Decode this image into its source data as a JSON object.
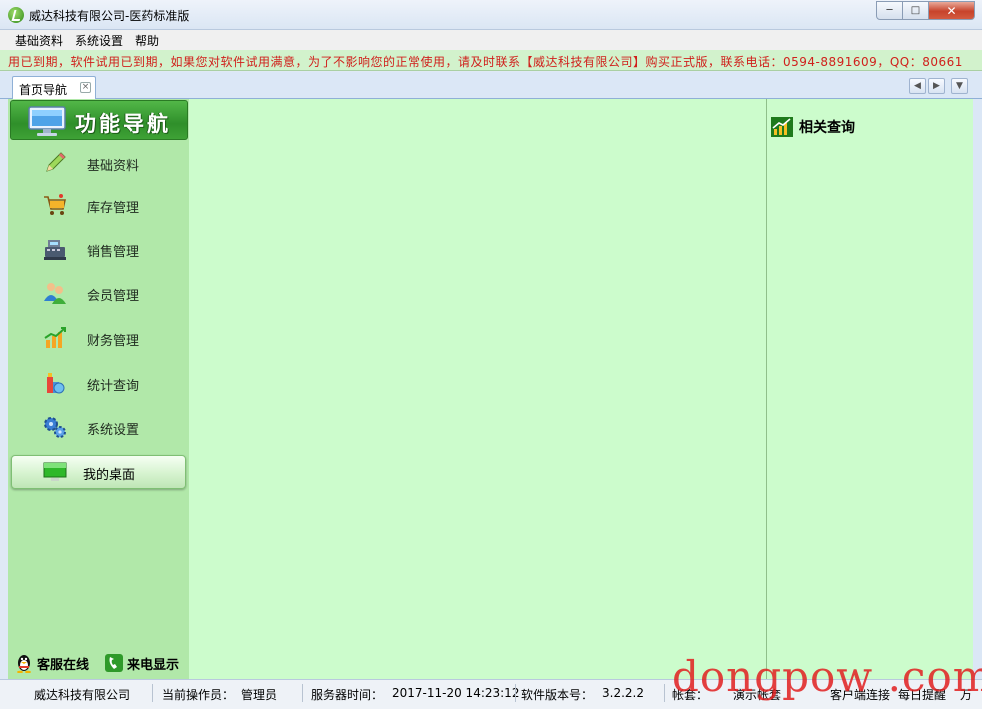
{
  "window": {
    "title": "威达科技有限公司-医药标准版",
    "minimize": "─",
    "maximize": "□",
    "close": "✕"
  },
  "menu": [
    "基础资料",
    "系统设置",
    "帮助"
  ],
  "marquee_text": "用已到期，软件试用已到期，如果您对软件试用满意，为了不影响您的正常使用，请及时联系【威达科技有限公司】购买正式版，联系电话：0594-8891609，QQ：80661",
  "tabs": [
    {
      "label": "首页导航"
    }
  ],
  "nav": {
    "header": "功能导航",
    "items": [
      {
        "label": "基础资料",
        "icon": "pencil-icon"
      },
      {
        "label": "库存管理",
        "icon": "cart-icon"
      },
      {
        "label": "销售管理",
        "icon": "cash-register-icon"
      },
      {
        "label": "会员管理",
        "icon": "members-icon"
      },
      {
        "label": "财务管理",
        "icon": "finance-chart-icon"
      },
      {
        "label": "统计查询",
        "icon": "stats-icon"
      },
      {
        "label": "系统设置",
        "icon": "gears-icon"
      }
    ],
    "desktop": "我的桌面",
    "service_online": "客服在线",
    "caller_display": "来电显示"
  },
  "right_panel": {
    "title": "相关查询"
  },
  "status": {
    "company": "威达科技有限公司",
    "operator_label": "当前操作员：",
    "operator": "管理员",
    "server_time_label": "服务器时间：",
    "server_time": "2017-11-20 14:23:12",
    "version_label": "软件版本号：",
    "version": "3.2.2.2",
    "account_label": "帐套：",
    "account": "演示帐套",
    "client": "客户端连接",
    "daily_reminder": "每日提醒",
    "extra": "万"
  },
  "watermark": "dongpow .com",
  "colors": {
    "main_bg": "#ccfccc",
    "nav_bg": "#b1e8a9",
    "marquee_text": "#d0201c",
    "header_green": "#2f8f2a"
  }
}
